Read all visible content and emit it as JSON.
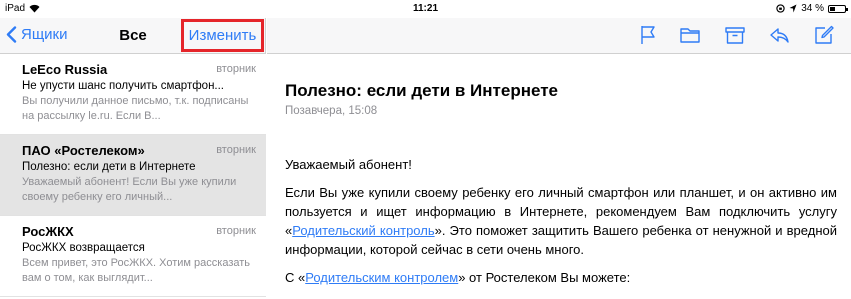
{
  "status": {
    "device": "iPad",
    "time": "11:21",
    "battery": "34 %",
    "battery_level": 0.34
  },
  "sidebar": {
    "back_label": "Ящики",
    "title": "Все",
    "edit_label": "Изменить",
    "messages": [
      {
        "sender": "LeEco Russia",
        "date": "вторник",
        "subject": "Не упусти шанс получить смартфон...",
        "preview": "Вы получили данное письмо, т.к. подписаны на рассылку le.ru. Если В..."
      },
      {
        "sender": "ПАО «Ростелеком»",
        "date": "вторник",
        "subject": "Полезно: если дети в Интернете",
        "preview": "Уважаемый абонент! Если Вы уже купили своему ребенку его личный..."
      },
      {
        "sender": "РосЖКХ",
        "date": "вторник",
        "subject": "РосЖКХ возвращается",
        "preview": "Всем привет, это РосЖКХ. Хотим рассказать вам о том, как выглядит..."
      }
    ]
  },
  "toolbar": {
    "icons": [
      "flag-icon",
      "folder-icon",
      "archive-icon",
      "reply-icon",
      "compose-icon"
    ]
  },
  "mail": {
    "title": "Полезно: если дети в Интернете",
    "date": "Позавчера, 15:08",
    "greeting": "Уважаемый абонент!",
    "p1_a": "Если Вы уже купили своему ребенку его личный смартфон или планшет, и он активно им пользуется и ищет информацию в Интернете, рекомендуем Вам подключить услугу «",
    "p1_link": "Родительский контроль",
    "p1_b": "». Это поможет защитить Вашего ребенка от ненужной и вредной информации, которой сейчас в сети очень много.",
    "p2_a": "С «",
    "p2_link": "Родительским контролем",
    "p2_b": "» от Ростелеком Вы можете:"
  },
  "colors": {
    "accent": "#2f7cf6",
    "highlight": "#e5252a",
    "secondary_text": "#8e8e93"
  }
}
